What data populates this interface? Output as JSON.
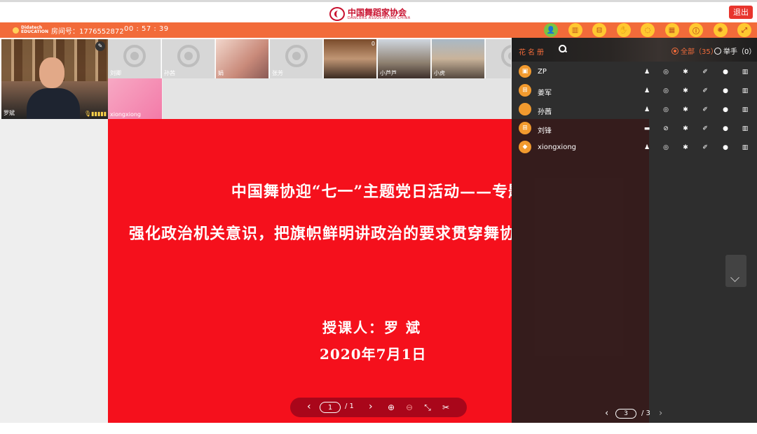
{
  "header": {
    "logo_cn": "中国舞蹈家协会",
    "logo_en": "DANCERS ASSOCIATION CHINA",
    "exit_label": "退出"
  },
  "toolbar": {
    "brand_line1": "Didatech",
    "brand_line2": "EDUCATION",
    "room_label": "房间号：1776552872",
    "timer": "00 : 57 : 39",
    "icons": [
      "users-icon",
      "book-icon",
      "toolbox-icon",
      "raise-hand-icon",
      "chat-icon",
      "calendar-icon",
      "info-icon",
      "settings-icon",
      "fullscreen-icon"
    ]
  },
  "main_video": {
    "name": "罗斌",
    "mic": "🎙▮▮▮▮▮"
  },
  "thumbnails": [
    {
      "name": "刘卿",
      "type": "empty"
    },
    {
      "name": "孙茜",
      "type": "empty"
    },
    {
      "name": "娟",
      "type": "photo1"
    },
    {
      "name": "张芳",
      "type": "empty"
    },
    {
      "name": "",
      "type": "photo2",
      "num": "0"
    },
    {
      "name": "小芦芦",
      "type": "photo3"
    },
    {
      "name": "小虎",
      "type": "photo4"
    },
    {
      "name": "",
      "type": "empty"
    },
    {
      "name": "xiongxiong",
      "type": "pink"
    }
  ],
  "slide": {
    "line1": "中国舞协迎“七一”主题党日活动——专题党课",
    "line2": "强化政治机关意识，把旗帜鲜明讲政治的要求贯穿舞协工作",
    "line3": "授课人：罗 斌",
    "line4": "2020年7月1日"
  },
  "slide_controls": {
    "page": "1",
    "total": "/ 1"
  },
  "roster": {
    "title": "花名册",
    "filter_all": "全部（35）",
    "filter_hand": "举手（0）",
    "members": [
      {
        "name": "ZP",
        "avatar": "▣"
      },
      {
        "name": "姜军",
        "avatar": "⊞"
      },
      {
        "name": "孙茜",
        "avatar": ""
      },
      {
        "name": "刘锋",
        "avatar": "⊞"
      },
      {
        "name": "xiongxiong",
        "avatar": "◆"
      }
    ],
    "page": "3",
    "total": "/ 3"
  }
}
